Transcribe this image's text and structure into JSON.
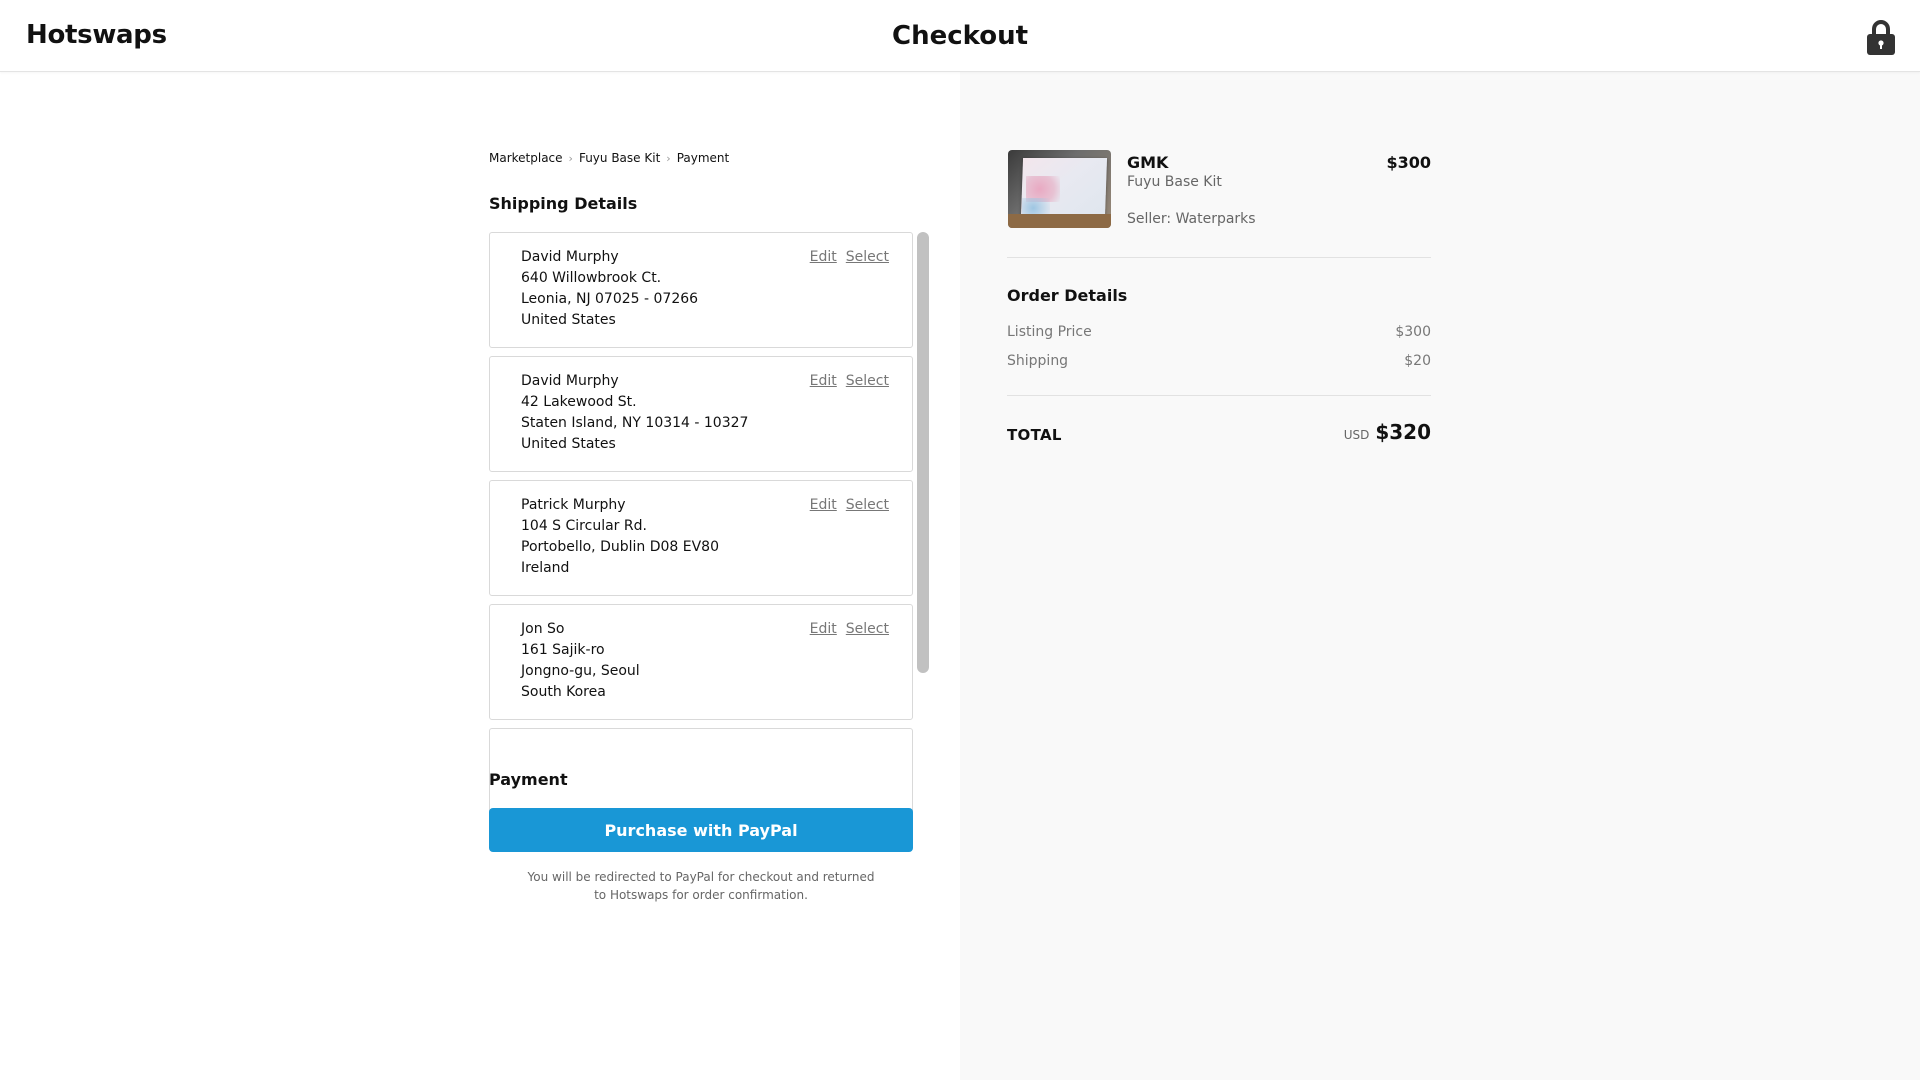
{
  "header": {
    "logo": "Hotswaps",
    "title": "Checkout",
    "lock_icon": "lock-icon"
  },
  "breadcrumb": [
    {
      "label": "Marketplace"
    },
    {
      "label": "Fuyu Base Kit"
    },
    {
      "label": "Payment"
    }
  ],
  "shipping": {
    "title": "Shipping Details",
    "edit_label": "Edit",
    "select_label": "Select",
    "addresses": [
      {
        "name": "David Murphy",
        "line1": "640 Willowbrook Ct.",
        "line2": "Leonia, NJ 07025 - 07266",
        "country": "United States"
      },
      {
        "name": "David Murphy",
        "line1": "42 Lakewood St.",
        "line2": "Staten Island, NY 10314 - 10327",
        "country": "United States"
      },
      {
        "name": "Patrick Murphy",
        "line1": "104 S Circular Rd.",
        "line2": "Portobello, Dublin D08 EV80",
        "country": "Ireland"
      },
      {
        "name": "Jon So",
        "line1": "161 Sajik-ro",
        "line2": "Jongno-gu, Seoul",
        "country": "South Korea"
      }
    ]
  },
  "payment": {
    "title": "Payment",
    "button_label": "Purchase with PayPal",
    "note_line1": "You will be redirected to PayPal for checkout and returned",
    "note_line2": "to Hotswaps for order confirmation.",
    "button_color": "#1997d6"
  },
  "product": {
    "brand": "GMK",
    "name": "Fuyu Base Kit",
    "seller": "Seller: Waterparks",
    "price": "$300"
  },
  "order_details": {
    "title": "Order Details",
    "rows": [
      {
        "label": "Listing Price",
        "value": "$300"
      },
      {
        "label": "Shipping",
        "value": "$20"
      }
    ],
    "total_label": "TOTAL",
    "currency": "USD",
    "total": "$320"
  }
}
